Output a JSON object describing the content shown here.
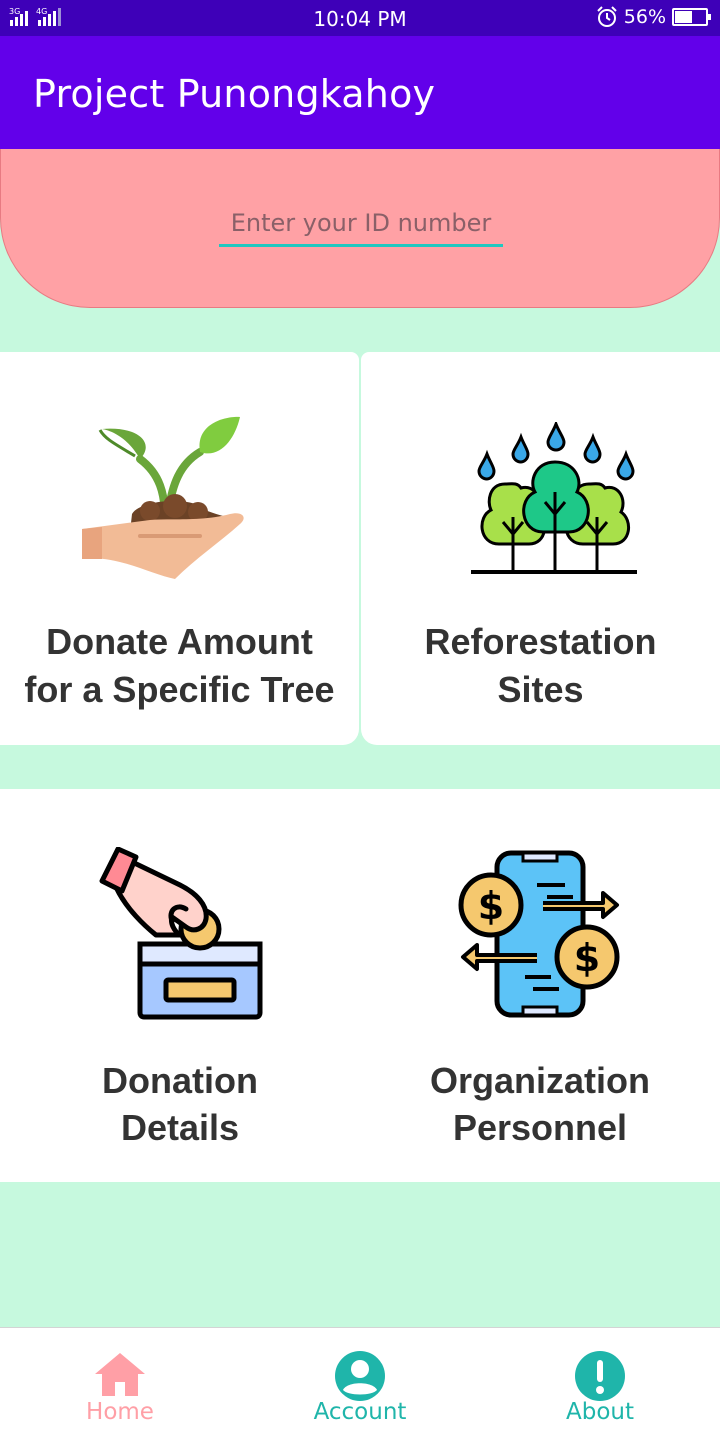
{
  "status_bar": {
    "time": "10:04 PM",
    "battery_percent": "56%",
    "battery_level": 0.56,
    "network_label_1": "3G",
    "network_label_2": "4G"
  },
  "app_bar": {
    "title": "Project Punongkahoy"
  },
  "id_input": {
    "placeholder": "Enter your ID number",
    "value": ""
  },
  "menu": {
    "donate_tree": {
      "line1": "Donate Amount",
      "line2": "for a Specific Tree",
      "icon": "sapling-hand-icon"
    },
    "reforestation": {
      "line1": "Reforestation",
      "line2": "Sites",
      "icon": "trees-rain-icon"
    },
    "donation_details": {
      "line1": "Donation",
      "line2": "Details",
      "icon": "coin-box-icon"
    },
    "personnel": {
      "line1": "Organization",
      "line2": "Personnel",
      "icon": "phone-money-icon"
    }
  },
  "bottom_nav": [
    {
      "label": "Home",
      "icon": "home-icon",
      "color": "#ff9fa6",
      "active": true
    },
    {
      "label": "Account",
      "icon": "account-icon",
      "color": "#1fb5aa",
      "active": false
    },
    {
      "label": "About",
      "icon": "info-icon",
      "color": "#1fb5aa",
      "active": false
    }
  ],
  "colors": {
    "status_bar": "#3e00b8",
    "app_bar": "#6200ea",
    "background": "#c6f9de",
    "id_panel": "#ffa1a5",
    "input_underline": "#1fc8c0"
  }
}
